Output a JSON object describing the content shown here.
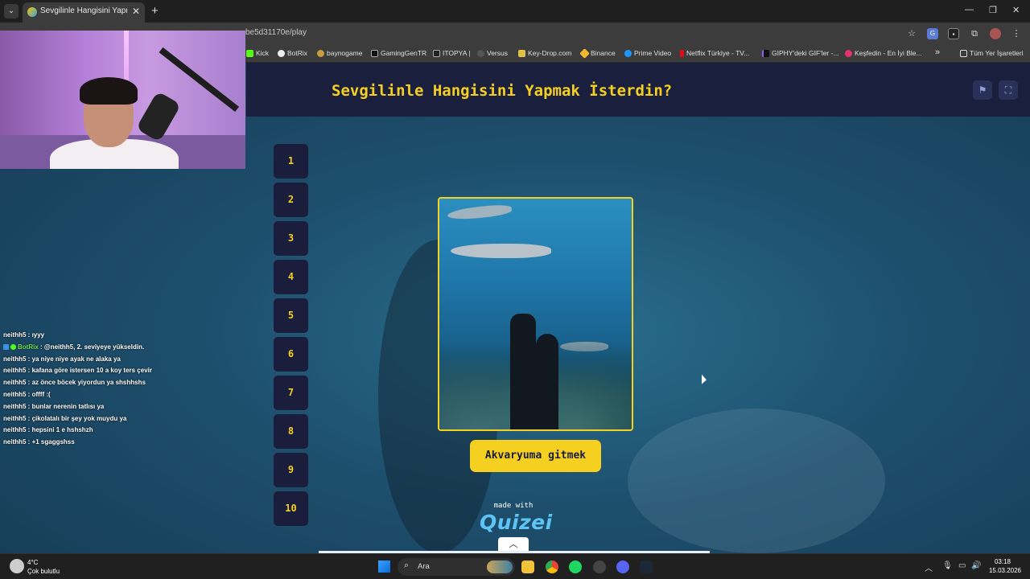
{
  "browser": {
    "tab_title": "Sevgilinle Hangisini Yapmak İst",
    "url": "be5d31170e/play",
    "bookmarks": [
      "Kick",
      "BotRix",
      "baynogame",
      "GamingGenTR",
      "ITOPYA |",
      "Versus",
      "Key-Drop.com",
      "Binance",
      "Prime Video",
      "Netflix Türkiye - TV...",
      "GIPHY'deki GIF'ler -...",
      "Keşfedin - En İyi Ble...",
      "»",
      "Tüm Yer İşaretleri"
    ]
  },
  "quiz": {
    "title": "Sevgilinle Hangisini Yapmak İsterdin?",
    "question_numbers": [
      "1",
      "2",
      "3",
      "4",
      "5",
      "6",
      "7",
      "8",
      "9",
      "10"
    ],
    "choice_label": "Akvaryuma gitmek",
    "made_with": "made with",
    "brand": "QUIZEI",
    "colors": {
      "accent": "#f5d020",
      "header_bg": "#1a1f3d",
      "button_bg": "#1a1d3b"
    }
  },
  "chat": [
    {
      "user": "neithh5",
      "text": " : ıyyy"
    },
    {
      "user": "BotRix",
      "text": " : @neithh5, 2. seviyeye yükseldin.",
      "bot": true
    },
    {
      "user": "neithh5",
      "text": " : ya niye niye ayak ne alaka ya"
    },
    {
      "user": "neithh5",
      "text": " : kafana göre istersen 10 a koy ters çevir"
    },
    {
      "user": "neithh5",
      "text": " : az önce böcek yiyordun ya shshhshs"
    },
    {
      "user": "neithh5",
      "text": " : offff :("
    },
    {
      "user": "neithh5",
      "text": " : bunlar nerenin tatlısı ya"
    },
    {
      "user": "neithh5",
      "text": " : çikolatalı bir şey yok muydu ya"
    },
    {
      "user": "neithh5",
      "text": " : hepsini 1 e hshshzh"
    },
    {
      "user": "neithh5",
      "text": " : +1 sgaggshss"
    }
  ],
  "taskbar": {
    "temp": "4°C",
    "weather": "Çok bulutlu",
    "search_label": "Ara",
    "time": "03:18",
    "date": "15.03.2026"
  }
}
